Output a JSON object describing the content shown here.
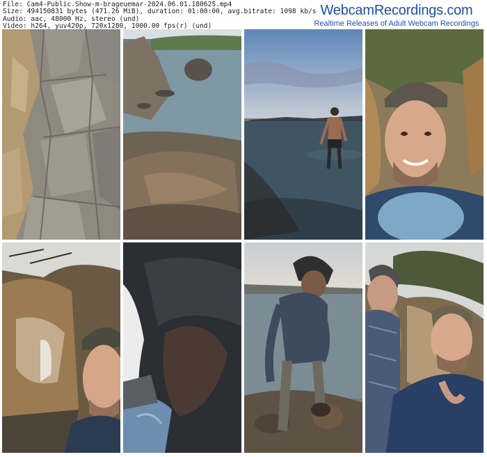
{
  "file_info": {
    "file_line": "File: Cam4-Public.Show-m-brageuemar-2024.06.01.180625.mp4",
    "size_line": "Size: 494150831 bytes (471.26 MiB), duration: 01:00:00, avg.bitrate: 1098 kb/s",
    "audio_line": "Audio: aac, 48000 Hz, stereo (und)",
    "video_line": "Video: h264, yuv420p, 720x1280, 1000.00 fps(r) (und)"
  },
  "brand": {
    "name": "WebcamRecordings.com",
    "tagline": "Realtime Releases of Adult Webcam Recordings"
  },
  "thumbnails": [
    {
      "scene": "stone-wall"
    },
    {
      "scene": "rocky-beach-shoreline"
    },
    {
      "scene": "man-standing-in-sea"
    },
    {
      "scene": "smiling-man-in-cap"
    },
    {
      "scene": "man-in-cap-by-rocks"
    },
    {
      "scene": "close-up-dark"
    },
    {
      "scene": "man-on-rocky-shore"
    },
    {
      "scene": "two-men-selfie"
    }
  ],
  "colors": {
    "brand_blue": "#1f4fa8",
    "meta_text": "#1a1a1a",
    "background": "#ffffff"
  }
}
